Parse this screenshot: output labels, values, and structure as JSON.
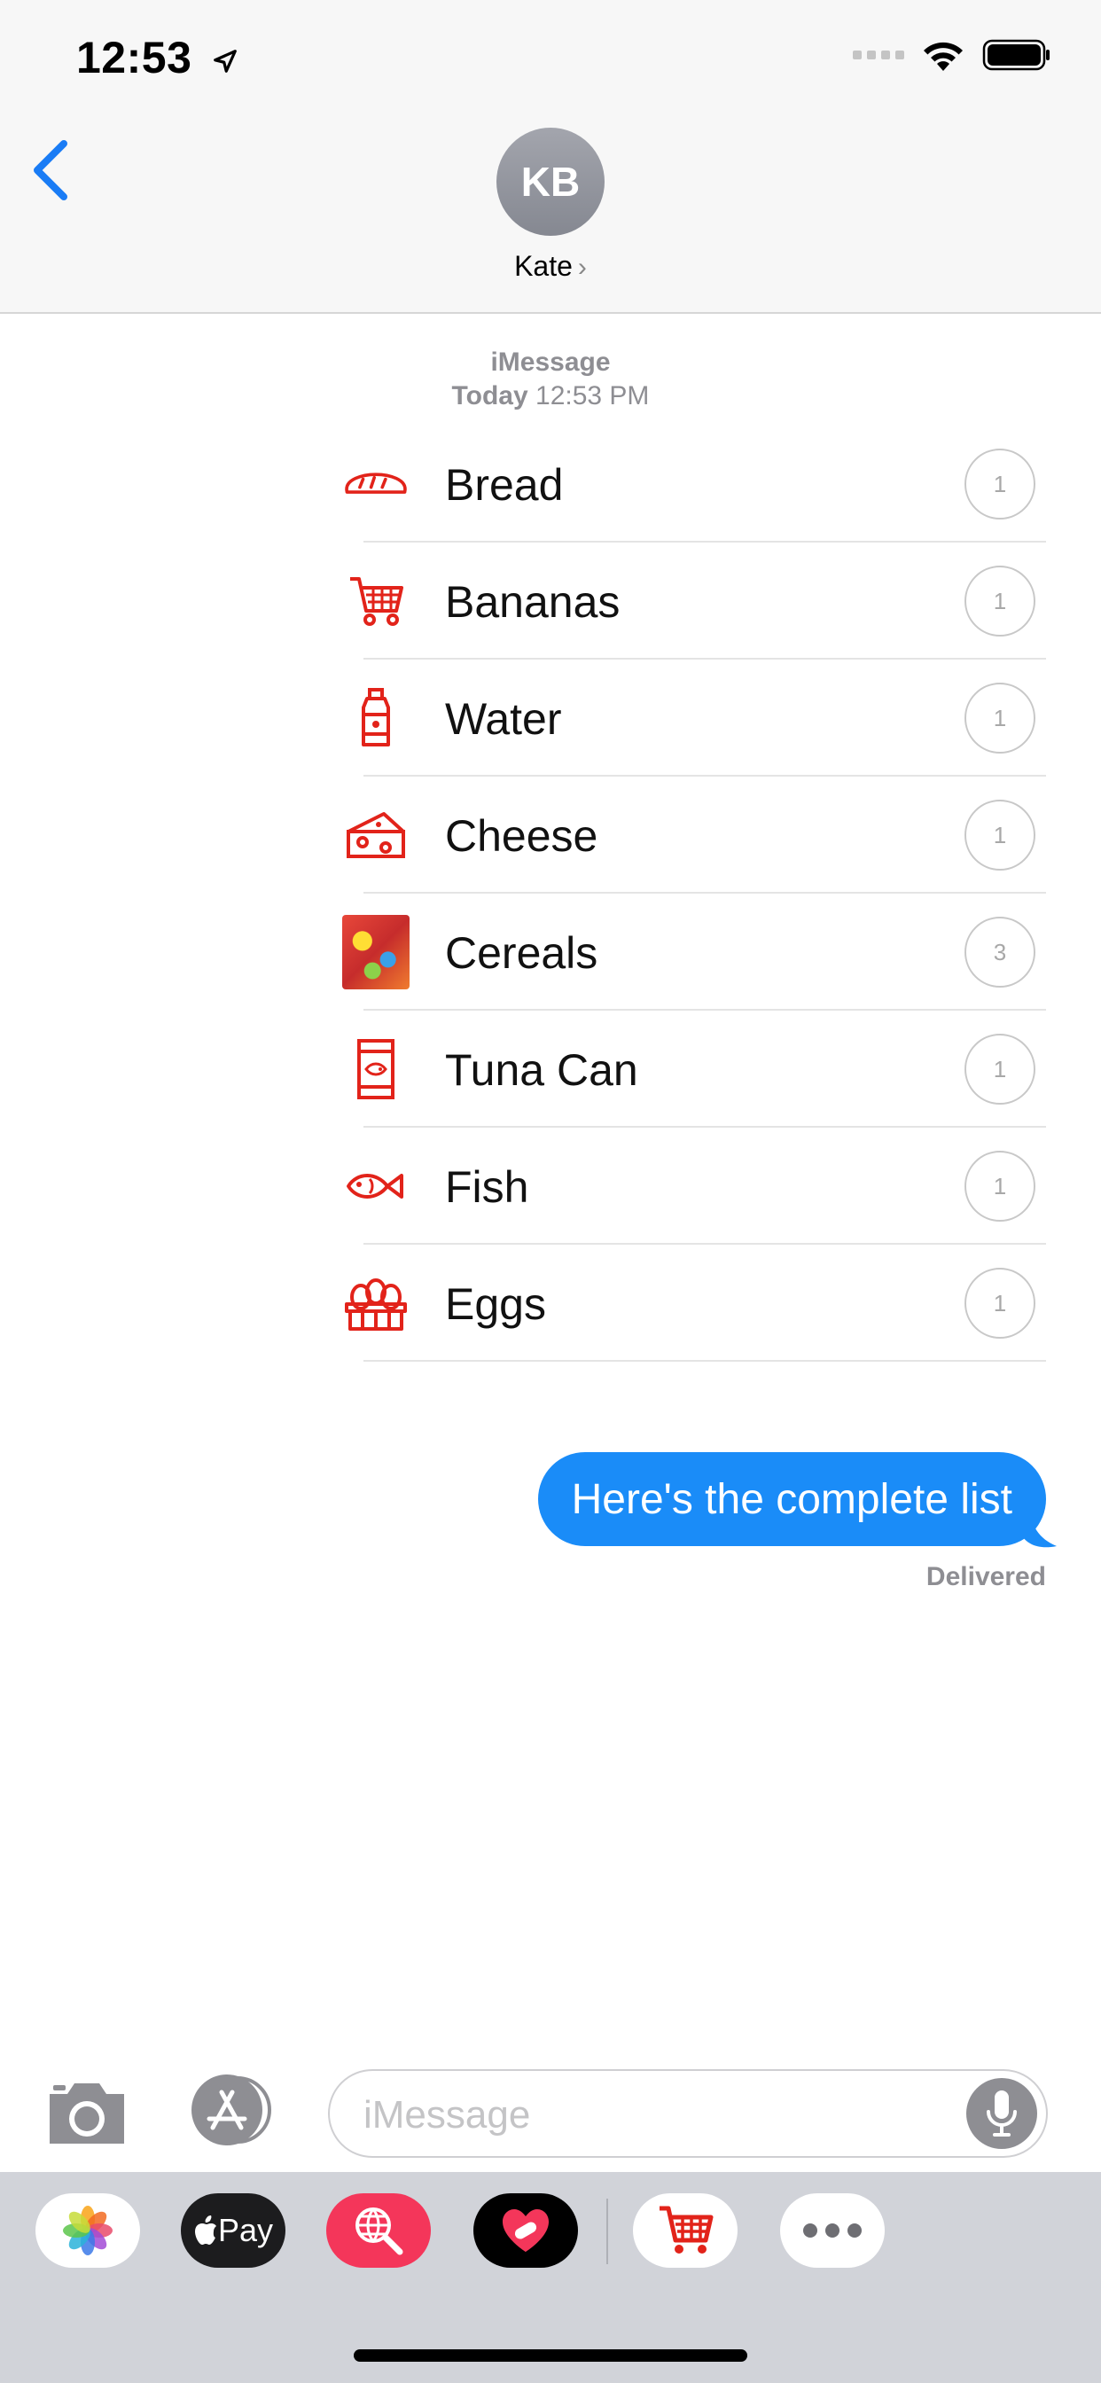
{
  "status_bar": {
    "time": "12:53"
  },
  "header": {
    "back_label": "Back",
    "avatar_initials": "KB",
    "contact_name": "Kate"
  },
  "meta": {
    "service": "iMessage",
    "day": "Today",
    "time": "12:53 PM"
  },
  "items": [
    {
      "name": "Bread",
      "qty": "1",
      "icon": "bread-icon"
    },
    {
      "name": "Bananas",
      "qty": "1",
      "icon": "shopping-cart-icon"
    },
    {
      "name": "Water",
      "qty": "1",
      "icon": "bottle-icon"
    },
    {
      "name": "Cheese",
      "qty": "1",
      "icon": "cheese-icon"
    },
    {
      "name": "Cereals",
      "qty": "3",
      "icon": "cereal-box-photo"
    },
    {
      "name": "Tuna Can",
      "qty": "1",
      "icon": "tuna-can-icon"
    },
    {
      "name": "Fish",
      "qty": "1",
      "icon": "fish-icon"
    },
    {
      "name": "Eggs",
      "qty": "1",
      "icon": "egg-carton-icon"
    }
  ],
  "message": {
    "text": "Here's the complete list",
    "status": "Delivered"
  },
  "composer": {
    "placeholder": "iMessage"
  },
  "drawer": {
    "apple_pay_label": "Pay"
  },
  "colors": {
    "accent": "#1a8cf8",
    "icon_red": "#e2231a",
    "drawer_bg": "#d1d3d9"
  }
}
